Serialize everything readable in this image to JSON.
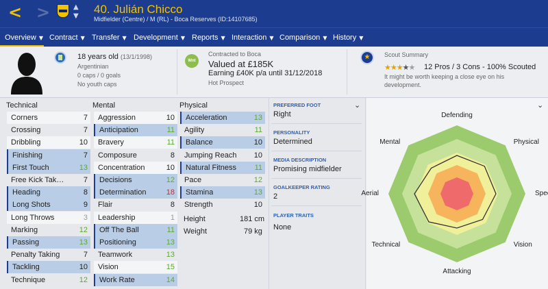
{
  "header": {
    "player_name": "40. Julián Chicco",
    "player_sub": "Midfielder (Centre) / M (RL) - Boca Reserves (ID:14107685)"
  },
  "menu": {
    "items": [
      {
        "label": "Overview"
      },
      {
        "label": "Contract"
      },
      {
        "label": "Transfer"
      },
      {
        "label": "Development"
      },
      {
        "label": "Reports"
      },
      {
        "label": "Interaction"
      },
      {
        "label": "Comparison"
      },
      {
        "label": "History"
      }
    ]
  },
  "info": {
    "age": "18 years old",
    "dob": "(13/1/1998)",
    "nationality": "Argentinian",
    "caps": "0 caps / 0 goals",
    "youth_caps": "No youth caps",
    "contract_with": "Contracted to Boca",
    "value": "Valued at £185K",
    "wnt_badge": "Wnt",
    "earning": "Earning £40K p/a until 31/12/2018",
    "status": "Hot Prospect",
    "scout_title": "Scout Summary",
    "stars": 3.5,
    "scout_stats": "12 Pros / 3 Cons - 100% Scouted",
    "scout_note_1": "It might be worth keeping a close eye on his",
    "scout_note_2": "development."
  },
  "attributes": {
    "technical_title": "Technical",
    "mental_title": "Mental",
    "physical_title": "Physical",
    "technical": [
      {
        "name": "Corners",
        "value": "7",
        "color": "normal",
        "hl": false
      },
      {
        "name": "Crossing",
        "value": "7",
        "color": "normal",
        "hl": false
      },
      {
        "name": "Dribbling",
        "value": "10",
        "color": "normal",
        "hl": false
      },
      {
        "name": "Finishing",
        "value": "7",
        "color": "normal",
        "hl": true
      },
      {
        "name": "First Touch",
        "value": "13",
        "color": "green",
        "hl": true
      },
      {
        "name": "Free Kick Tak…",
        "value": "7",
        "color": "normal",
        "hl": false
      },
      {
        "name": "Heading",
        "value": "8",
        "color": "normal",
        "hl": true
      },
      {
        "name": "Long Shots",
        "value": "9",
        "color": "normal",
        "hl": true
      },
      {
        "name": "Long Throws",
        "value": "3",
        "color": "gray",
        "hl": false
      },
      {
        "name": "Marking",
        "value": "12",
        "color": "green",
        "hl": false
      },
      {
        "name": "Passing",
        "value": "13",
        "color": "green",
        "hl": true
      },
      {
        "name": "Penalty Taking",
        "value": "7",
        "color": "normal",
        "hl": false
      },
      {
        "name": "Tackling",
        "value": "10",
        "color": "normal",
        "hl": true
      },
      {
        "name": "Technique",
        "value": "12",
        "color": "green",
        "hl": false
      }
    ],
    "mental": [
      {
        "name": "Aggression",
        "value": "10",
        "color": "normal",
        "hl": false
      },
      {
        "name": "Anticipation",
        "value": "11",
        "color": "green",
        "hl": true
      },
      {
        "name": "Bravery",
        "value": "11",
        "color": "green",
        "hl": false
      },
      {
        "name": "Composure",
        "value": "8",
        "color": "normal",
        "hl": false
      },
      {
        "name": "Concentration",
        "value": "10",
        "color": "normal",
        "hl": false
      },
      {
        "name": "Decisions",
        "value": "12",
        "color": "green",
        "hl": true
      },
      {
        "name": "Determination",
        "value": "18",
        "color": "red",
        "hl": true
      },
      {
        "name": "Flair",
        "value": "8",
        "color": "normal",
        "hl": false
      },
      {
        "name": "Leadership",
        "value": "1",
        "color": "gray",
        "hl": false
      },
      {
        "name": "Off The Ball",
        "value": "11",
        "color": "green",
        "hl": true
      },
      {
        "name": "Positioning",
        "value": "13",
        "color": "green",
        "hl": true
      },
      {
        "name": "Teamwork",
        "value": "13",
        "color": "green",
        "hl": false
      },
      {
        "name": "Vision",
        "value": "15",
        "color": "green",
        "hl": false
      },
      {
        "name": "Work Rate",
        "value": "14",
        "color": "green",
        "hl": true
      }
    ],
    "physical": [
      {
        "name": "Acceleration",
        "value": "13",
        "color": "green",
        "hl": true
      },
      {
        "name": "Agility",
        "value": "11",
        "color": "green",
        "hl": false
      },
      {
        "name": "Balance",
        "value": "10",
        "color": "normal",
        "hl": true
      },
      {
        "name": "Jumping Reach",
        "value": "10",
        "color": "normal",
        "hl": false
      },
      {
        "name": "Natural Fitness",
        "value": "11",
        "color": "green",
        "hl": true
      },
      {
        "name": "Pace",
        "value": "12",
        "color": "green",
        "hl": false
      },
      {
        "name": "Stamina",
        "value": "13",
        "color": "green",
        "hl": true
      },
      {
        "name": "Strength",
        "value": "10",
        "color": "normal",
        "hl": false
      }
    ],
    "height_label": "Height",
    "height_value": "181 cm",
    "weight_label": "Weight",
    "weight_value": "79 kg"
  },
  "details": {
    "pref_foot_head": "PREFERRED FOOT",
    "pref_foot": "Right",
    "personality_head": "PERSONALITY",
    "personality": "Determined",
    "media_head": "MEDIA DESCRIPTION",
    "media": "Promising midfielder",
    "gk_head": "GOALKEEPER RATING",
    "gk": "2",
    "traits_head": "PLAYER TRAITS",
    "traits": "None"
  },
  "radar": {
    "labels": [
      "Defending",
      "Physical",
      "Speed",
      "Vision",
      "Attacking",
      "Technical",
      "Aerial",
      "Mental"
    ],
    "player_values": [
      0.56,
      0.57,
      0.57,
      0.53,
      0.5,
      0.58,
      0.62,
      0.53
    ],
    "colors": {
      "outer": "#9ccb6e",
      "mid": "#c6e29a",
      "inner_yellow": "#f0ef9a",
      "orange": "#f6b45c",
      "red": "#ef6a6a",
      "line": "#333333"
    }
  },
  "colors": {
    "header_bg": "#1b3c8f",
    "accent": "#f2c200",
    "highlight_row": "#b9cde6"
  }
}
